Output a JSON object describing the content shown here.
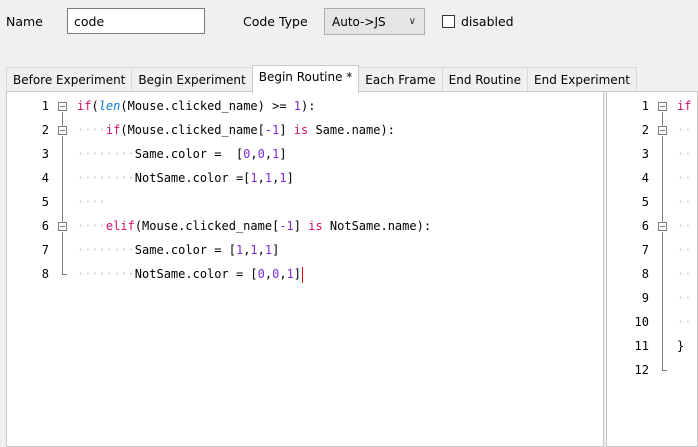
{
  "form": {
    "name_label": "Name",
    "name_value": "code",
    "code_type_label": "Code Type",
    "code_type_value": "Auto->JS",
    "disabled_label": "disabled"
  },
  "tabs": [
    {
      "label": "Before Experiment"
    },
    {
      "label": "Begin Experiment"
    },
    {
      "label": "Begin Routine *"
    },
    {
      "label": "Each Frame"
    },
    {
      "label": "End Routine"
    },
    {
      "label": "End Experiment"
    }
  ],
  "left_editor": {
    "line_numbers": [
      "1",
      "2",
      "3",
      "4",
      "5",
      "6",
      "7",
      "8"
    ],
    "lines": [
      "if(len(Mouse.clicked_name) >= 1):",
      "    if(Mouse.clicked_name[-1] is Same.name):",
      "        Same.color =  [0,0,1]",
      "        NotSame.color =[1,1,1]",
      "",
      "    elif(Mouse.clicked_name[-1] is NotSame.name):",
      "        Same.color = [1,1,1]",
      "        NotSame.color = [0,0,1]"
    ]
  },
  "right_editor": {
    "line_numbers": [
      "1",
      "2",
      "3",
      "4",
      "5",
      "6",
      "7",
      "8",
      "9",
      "10",
      "11",
      "12"
    ],
    "line1_text": "if",
    "line11_text": "}"
  },
  "colors": {
    "keyword": "#d11070",
    "function": "#0d7bd6",
    "number": "#7f2ad6",
    "cursor": "#dd0000"
  }
}
